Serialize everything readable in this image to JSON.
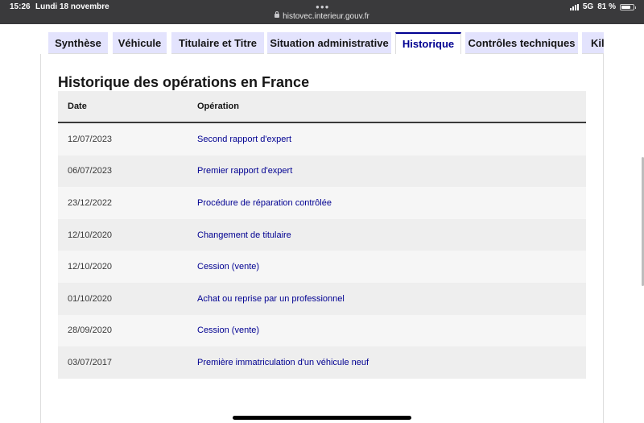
{
  "status_bar": {
    "time": "15:26",
    "date": "Lundi 18 novembre",
    "url": "histovec.interieur.gouv.fr",
    "network": "5G",
    "battery": "81 %",
    "battery_level": 0.81
  },
  "tabs": [
    {
      "label": "Synthèse",
      "active": false
    },
    {
      "label": "Véhicule",
      "active": false
    },
    {
      "label": "Titulaire et Titre",
      "active": false
    },
    {
      "label": "Situation administrative",
      "active": false
    },
    {
      "label": "Historique",
      "active": true
    },
    {
      "label": "Contrôles techniques",
      "active": false
    },
    {
      "label": "Kilo",
      "active": false
    }
  ],
  "section": {
    "title": "Historique des opérations en France"
  },
  "table": {
    "headers": {
      "date": "Date",
      "operation": "Opération"
    },
    "rows": [
      {
        "date": "12/07/2023",
        "operation": "Second rapport d'expert"
      },
      {
        "date": "06/07/2023",
        "operation": "Premier rapport d'expert"
      },
      {
        "date": "23/12/2022",
        "operation": "Procédure de réparation contrôlée"
      },
      {
        "date": "12/10/2020",
        "operation": "Changement de titulaire"
      },
      {
        "date": "12/10/2020",
        "operation": "Cession (vente)"
      },
      {
        "date": "01/10/2020",
        "operation": "Achat ou reprise par un professionnel"
      },
      {
        "date": "28/09/2020",
        "operation": "Cession (vente)"
      },
      {
        "date": "03/07/2017",
        "operation": "Première immatriculation d'un véhicule neuf"
      }
    ]
  },
  "colors": {
    "accent": "#000091",
    "tab_background": "#e3e3fd",
    "text": "#161616"
  },
  "icons": [
    "lock-icon",
    "signal-icon",
    "battery-icon"
  ]
}
